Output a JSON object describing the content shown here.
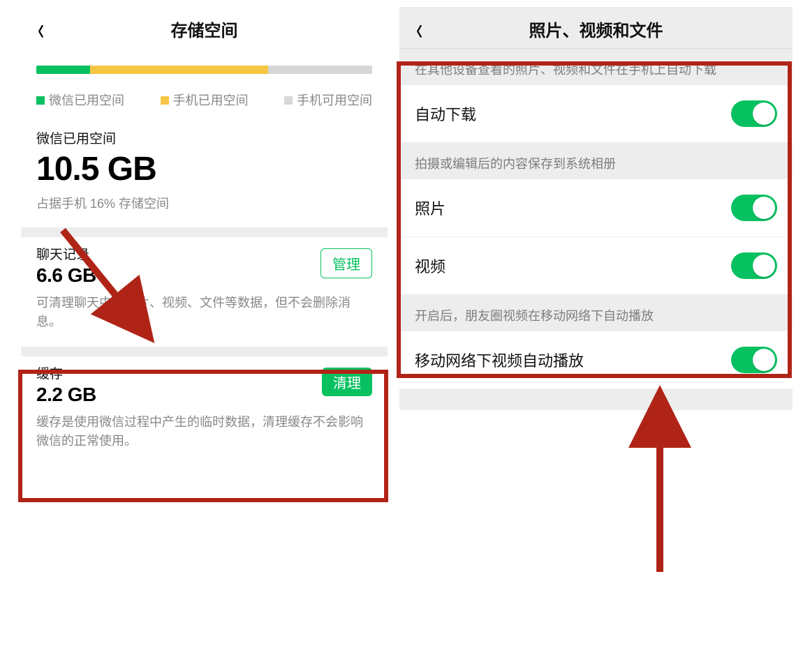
{
  "left": {
    "title": "存储空间",
    "bar": {
      "green_pct": 16,
      "yellow_pct": 53,
      "grey_pct": 31
    },
    "legend": {
      "green": "微信已用空间",
      "yellow": "手机已用空间",
      "grey": "手机可用空间"
    },
    "used": {
      "label": "微信已用空间",
      "value": "10.5 GB",
      "sub": "占据手机 16% 存储空间"
    },
    "chat": {
      "label": "聊天记录",
      "value": "6.6 GB",
      "btn": "管理",
      "desc": "可清理聊天中的图片、视频、文件等数据，但不会删除消息。"
    },
    "cache": {
      "label": "缓存",
      "value": "2.2 GB",
      "btn": "清理",
      "desc": "缓存是使用微信过程中产生的临时数据，清理缓存不会影响微信的正常使用。"
    }
  },
  "right": {
    "title": "照片、视频和文件",
    "group1_title": "在其他设备查看的照片、视频和文件在手机上自动下载",
    "auto_download": "自动下载",
    "group2_title": "拍摄或编辑后的内容保存到系统相册",
    "photo": "照片",
    "video": "视频",
    "group3_title": "开启后，朋友圈视频在移动网络下自动播放",
    "autoplay": "移动网络下视频自动播放"
  },
  "annotation_color": "#b02418"
}
